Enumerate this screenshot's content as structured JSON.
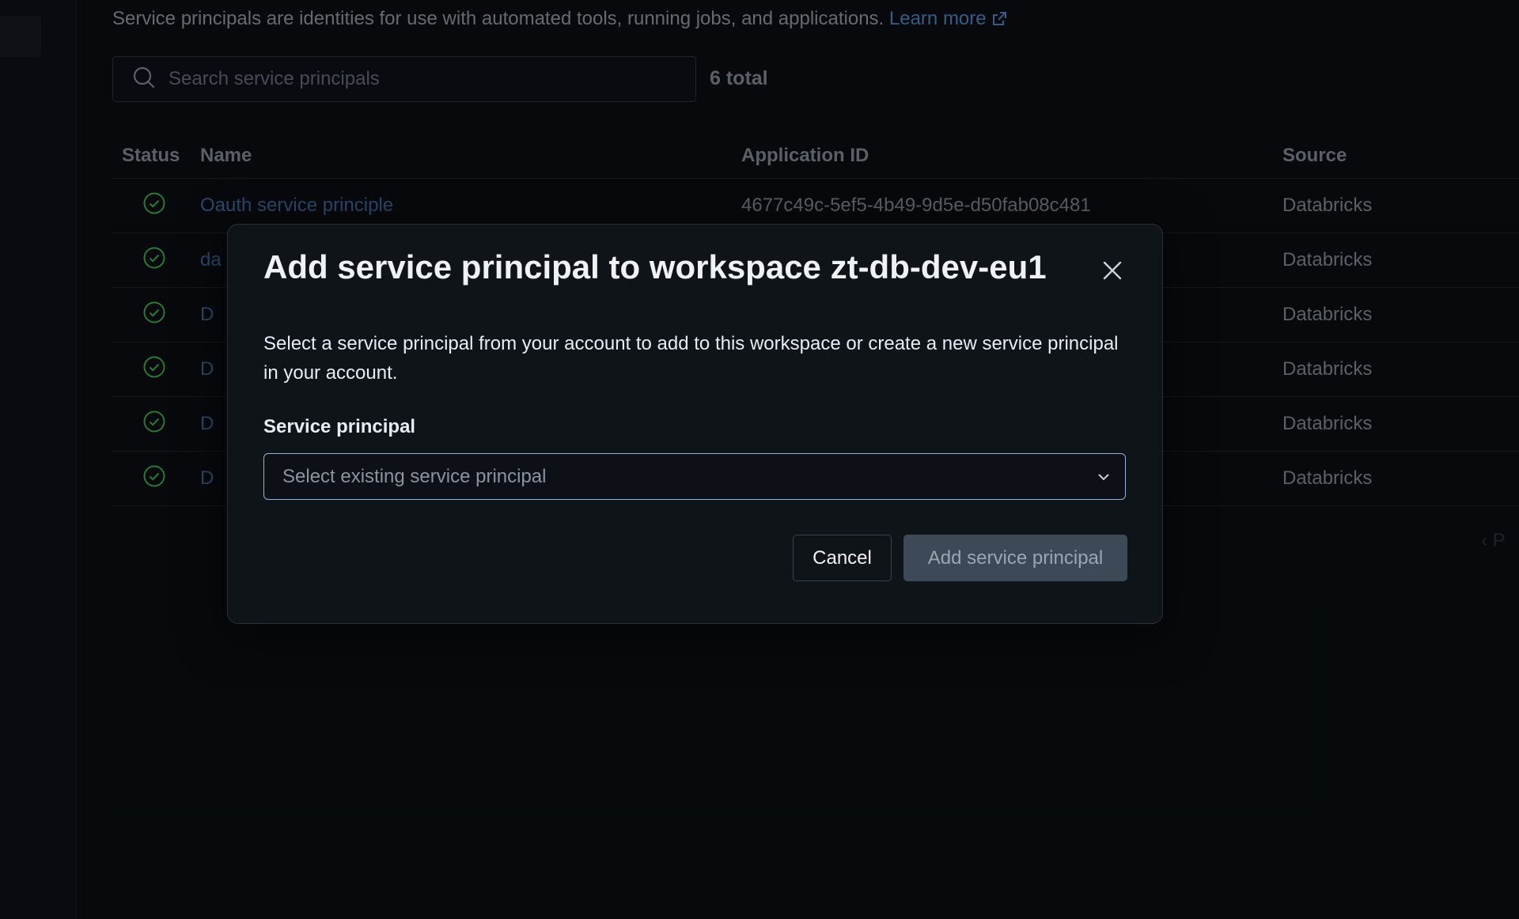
{
  "page": {
    "intro_text": "Service principals are identities for use with automated tools, running jobs, and applications.",
    "learn_more": "Learn more",
    "icons": {
      "external_link": "external-link-icon",
      "search": "search-icon",
      "status": "check-circle-icon",
      "close": "close-icon",
      "chevron": "chevron-down-icon"
    }
  },
  "search": {
    "placeholder": "Search service principals",
    "value": ""
  },
  "total": "6 total",
  "table": {
    "headers": {
      "status": "Status",
      "name": "Name",
      "app_id": "Application ID",
      "source": "Source"
    },
    "rows": [
      {
        "name": "Oauth service principle",
        "app_id": "4677c49c-5ef5-4b49-9d5e-d50fab08c481",
        "source": "Databricks"
      },
      {
        "name": "da",
        "app_id": "",
        "source": "Databricks"
      },
      {
        "name": "D",
        "app_id": "",
        "source": "Databricks"
      },
      {
        "name": "D",
        "app_id": "",
        "source": "Databricks"
      },
      {
        "name": "D",
        "app_id": "",
        "source": "Databricks"
      },
      {
        "name": "D",
        "app_id": "",
        "source": "Databricks"
      }
    ]
  },
  "pager": {
    "label": "‹  P"
  },
  "modal": {
    "title": "Add service principal to workspace zt-db-dev-eu1",
    "description": "Select a service principal from your account to add to this workspace or create a new service principal in your account.",
    "field_label": "Service principal",
    "select_placeholder": "Select existing service principal",
    "cancel_label": "Cancel",
    "add_label": "Add service principal"
  },
  "colors": {
    "background": "#0b0f14",
    "link": "#4f8ed0",
    "status_green": "#3fb950",
    "select_focus_border": "#8fb3d9",
    "disabled_button": "#3d4956"
  }
}
